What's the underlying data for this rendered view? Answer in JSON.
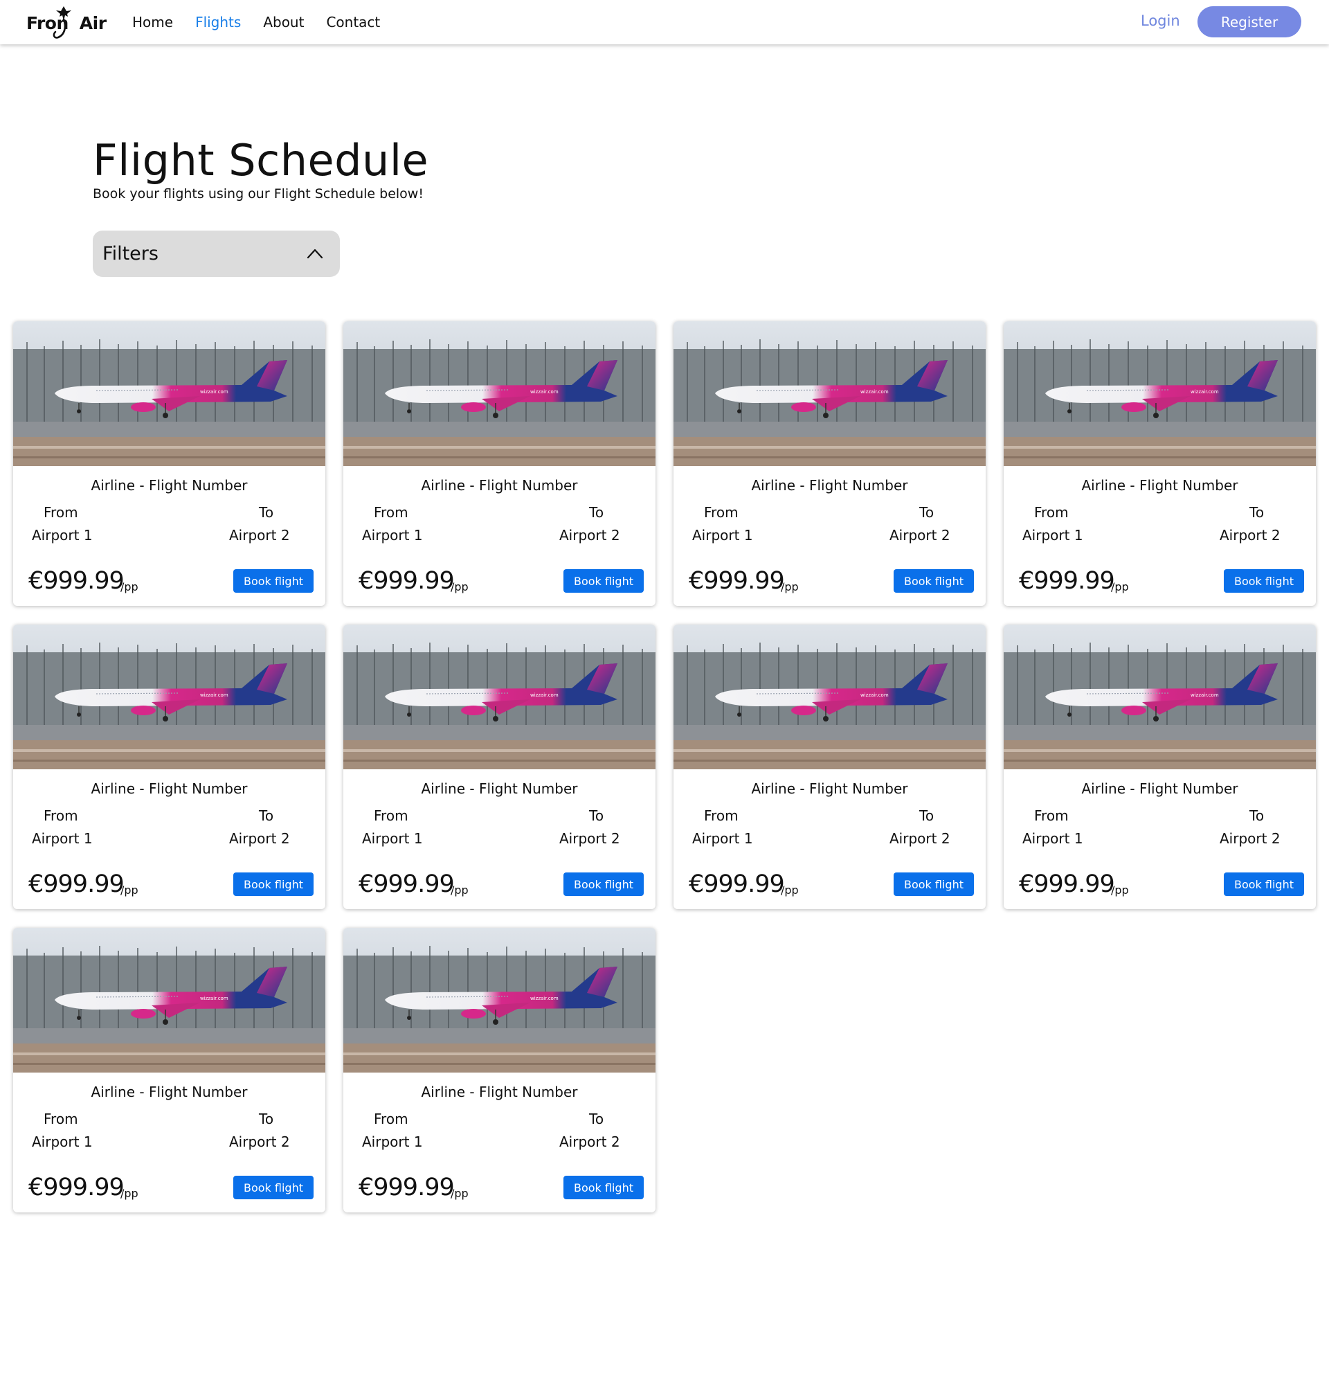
{
  "nav": {
    "logo_text_left": "Fron",
    "logo_text_right": "Air",
    "links": [
      "Home",
      "Flights",
      "About",
      "Contact"
    ],
    "active_link": "Flights",
    "login": "Login",
    "register": "Register",
    "accent_color": "#1a7fe8",
    "register_color": "#7789e3"
  },
  "header": {
    "title": "Flight Schedule",
    "subtitle": "Book your flights using our Flight Schedule below!"
  },
  "filters": {
    "label": "Filters",
    "icon": "chevron-up-icon"
  },
  "cards": [
    {
      "title": "Airline - Flight Number",
      "from_label": "From",
      "to_label": "To",
      "from": "Airport 1",
      "to": "Airport 2",
      "price": "€999.99",
      "per": "/pp",
      "button": "Book flight"
    },
    {
      "title": "Airline - Flight Number",
      "from_label": "From",
      "to_label": "To",
      "from": "Airport 1",
      "to": "Airport 2",
      "price": "€999.99",
      "per": "/pp",
      "button": "Book flight"
    },
    {
      "title": "Airline - Flight Number",
      "from_label": "From",
      "to_label": "To",
      "from": "Airport 1",
      "to": "Airport 2",
      "price": "€999.99",
      "per": "/pp",
      "button": "Book flight"
    },
    {
      "title": "Airline - Flight Number",
      "from_label": "From",
      "to_label": "To",
      "from": "Airport 1",
      "to": "Airport 2",
      "price": "€999.99",
      "per": "/pp",
      "button": "Book flight"
    },
    {
      "title": "Airline - Flight Number",
      "from_label": "From",
      "to_label": "To",
      "from": "Airport 1",
      "to": "Airport 2",
      "price": "€999.99",
      "per": "/pp",
      "button": "Book flight"
    },
    {
      "title": "Airline - Flight Number",
      "from_label": "From",
      "to_label": "To",
      "from": "Airport 1",
      "to": "Airport 2",
      "price": "€999.99",
      "per": "/pp",
      "button": "Book flight"
    },
    {
      "title": "Airline - Flight Number",
      "from_label": "From",
      "to_label": "To",
      "from": "Airport 1",
      "to": "Airport 2",
      "price": "€999.99",
      "per": "/pp",
      "button": "Book flight"
    },
    {
      "title": "Airline - Flight Number",
      "from_label": "From",
      "to_label": "To",
      "from": "Airport 1",
      "to": "Airport 2",
      "price": "€999.99",
      "per": "/pp",
      "button": "Book flight"
    },
    {
      "title": "Airline - Flight Number",
      "from_label": "From",
      "to_label": "To",
      "from": "Airport 1",
      "to": "Airport 2",
      "price": "€999.99",
      "per": "/pp",
      "button": "Book flight"
    },
    {
      "title": "Airline - Flight Number",
      "from_label": "From",
      "to_label": "To",
      "from": "Airport 1",
      "to": "Airport 2",
      "price": "€999.99",
      "per": "/pp",
      "button": "Book flight"
    }
  ],
  "card_image": {
    "icon": "airplane-photo-icon",
    "plane_text": "wizzair.com",
    "colors": {
      "pink": "#d6288a",
      "blue": "#243a8c",
      "sky": "#c9d2da",
      "runway": "#9a8473"
    }
  },
  "button_color": "#0a70ea"
}
